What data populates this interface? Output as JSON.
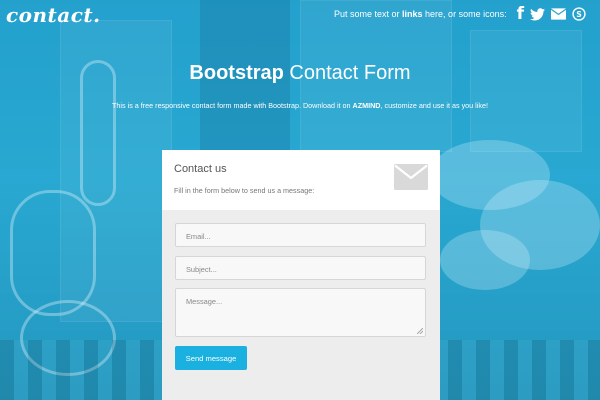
{
  "logo": "contact.",
  "topbar": {
    "text_before": "Put some text or ",
    "link": "links",
    "text_after": " here, or some icons:",
    "icons": [
      "facebook-icon",
      "twitter-icon",
      "email-icon",
      "skype-icon"
    ]
  },
  "hero": {
    "title_strong": "Bootstrap",
    "title_light": " Contact Form",
    "subtitle_before": "This is a free responsive contact form made with Bootstrap. Download it on ",
    "subtitle_link": "AZMIND",
    "subtitle_after": ", customize and use it as you like!"
  },
  "form": {
    "title": "Contact us",
    "description": "Fill in the form below to send us a message:",
    "email_placeholder": "Email...",
    "subject_placeholder": "Subject...",
    "message_placeholder": "Message...",
    "submit_label": "Send message"
  },
  "colors": {
    "accent": "#1ab0e0",
    "background": "#2aa8cf",
    "form_body": "#ededed"
  }
}
